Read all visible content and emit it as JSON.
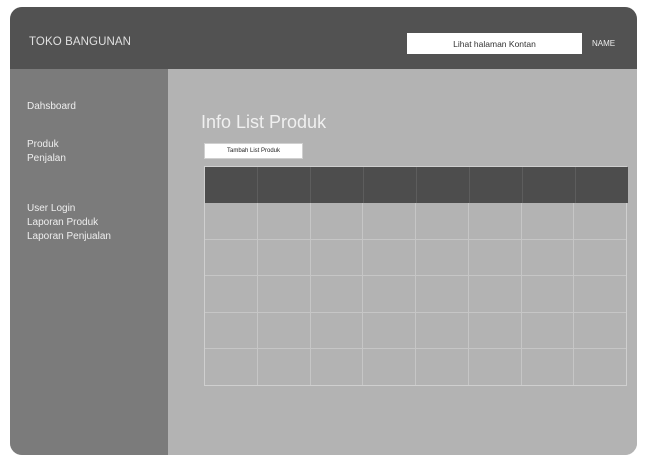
{
  "header": {
    "brand": "TOKO BANGUNAN",
    "link_label": "Lihat halaman Kontan",
    "user_name": "NAME"
  },
  "sidebar": {
    "items": [
      {
        "label": "Dahsboard"
      },
      {
        "label": "Produk"
      },
      {
        "label": "Penjalan"
      },
      {
        "label": "User Login"
      },
      {
        "label": "Laporan Produk"
      },
      {
        "label": "Laporan Penjualan"
      }
    ]
  },
  "main": {
    "title": "Info List Produk",
    "add_button_label": "Tambah List Produk",
    "table": {
      "columns": [
        "",
        "",
        "",
        "",
        "",
        "",
        "",
        ""
      ],
      "rows": [
        [
          "",
          "",
          "",
          "",
          "",
          "",
          "",
          ""
        ],
        [
          "",
          "",
          "",
          "",
          "",
          "",
          "",
          ""
        ],
        [
          "",
          "",
          "",
          "",
          "",
          "",
          "",
          ""
        ],
        [
          "",
          "",
          "",
          "",
          "",
          "",
          "",
          ""
        ],
        [
          "",
          "",
          "",
          "",
          "",
          "",
          "",
          ""
        ]
      ]
    }
  },
  "colors": {
    "header_bg": "#525252",
    "sidebar_bg": "#7b7b7b",
    "content_bg": "#b3b3b3",
    "table_header_bg": "#4d4d4d"
  }
}
